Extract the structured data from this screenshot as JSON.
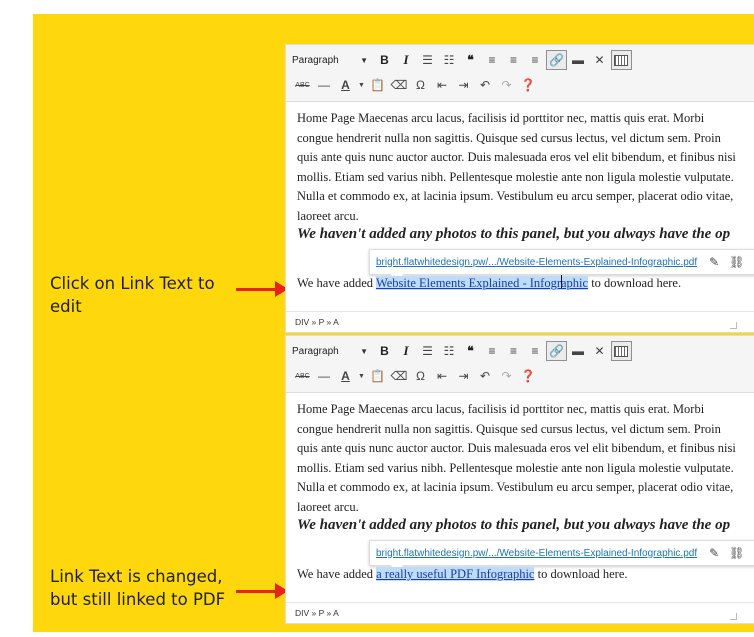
{
  "annotations": {
    "top": "Click on Link Text to edit",
    "bottom": "Link Text is changed, but still linked to PDF"
  },
  "colors": {
    "background": "#ffd70d",
    "arrow": "#e8221c",
    "link_highlight": "#bcdcfa"
  },
  "toolbar": {
    "format_select": "Paragraph",
    "row1_icons": [
      "bold-icon",
      "italic-icon",
      "bullet-list-icon",
      "numbered-list-icon",
      "blockquote-icon",
      "align-left-icon",
      "align-center-icon",
      "align-right-icon",
      "insert-link-icon",
      "read-more-icon",
      "fullscreen-icon",
      "toolbar-toggle-icon"
    ],
    "row2_icons": [
      "strikethrough-icon",
      "horizontal-line-icon",
      "text-color-icon",
      "paste-as-text-icon",
      "clear-formatting-icon",
      "special-character-icon",
      "outdent-icon",
      "indent-icon",
      "undo-icon",
      "redo-icon",
      "help-icon"
    ]
  },
  "editors": [
    {
      "paragraph": "Home Page Maecenas arcu lacus, facilisis id porttitor nec, mattis quis erat. Morbi congue hendrerit nulla non sagittis. Quisque sed cursus lectus, vel dictum sem. Proin quis ante quis nunc auctor auctor. Duis malesuada eros vel elit bibendum, et finibus nisi mollis. Etiam sed varius nibh. Pellentesque molestie ante non ligula molestie vulputate. Nulla et commodo ex, at lacinia ipsum. Vestibulum eu arcu semper, placerat odio vitae, laoreet arcu.",
      "heading": "We haven't added any photos to this panel, but you always have the op",
      "link_url": "bright.flatwhitedesign.pw/.../Website-Elements-Explained-Infographic.pdf",
      "line_before": "We have added",
      "link_text_a": "Website Elements Explained - Infogr",
      "link_text_b": "aphic",
      "line_after": "to download here.",
      "path": "DIV » P » A"
    },
    {
      "paragraph": "Home Page Maecenas arcu lacus, facilisis id porttitor nec, mattis quis erat. Morbi congue hendrerit nulla non sagittis. Quisque sed cursus lectus, vel dictum sem. Proin quis ante quis nunc auctor auctor. Duis malesuada eros vel elit bibendum, et finibus nisi mollis. Etiam sed varius nibh. Pellentesque molestie ante non ligula molestie vulputate. Nulla et commodo ex, at lacinia ipsum. Vestibulum eu arcu semper, placerat odio vitae, laoreet arcu.",
      "heading": "We haven't added any photos to this panel, but you always have the op",
      "link_url": "bright.flatwhitedesign.pw/.../Website-Elements-Explained-Infographic.pdf",
      "line_before": "We have added",
      "link_text": "a really useful PDF Infographic",
      "line_after": "to download here.",
      "path": "DIV » P » A"
    }
  ]
}
